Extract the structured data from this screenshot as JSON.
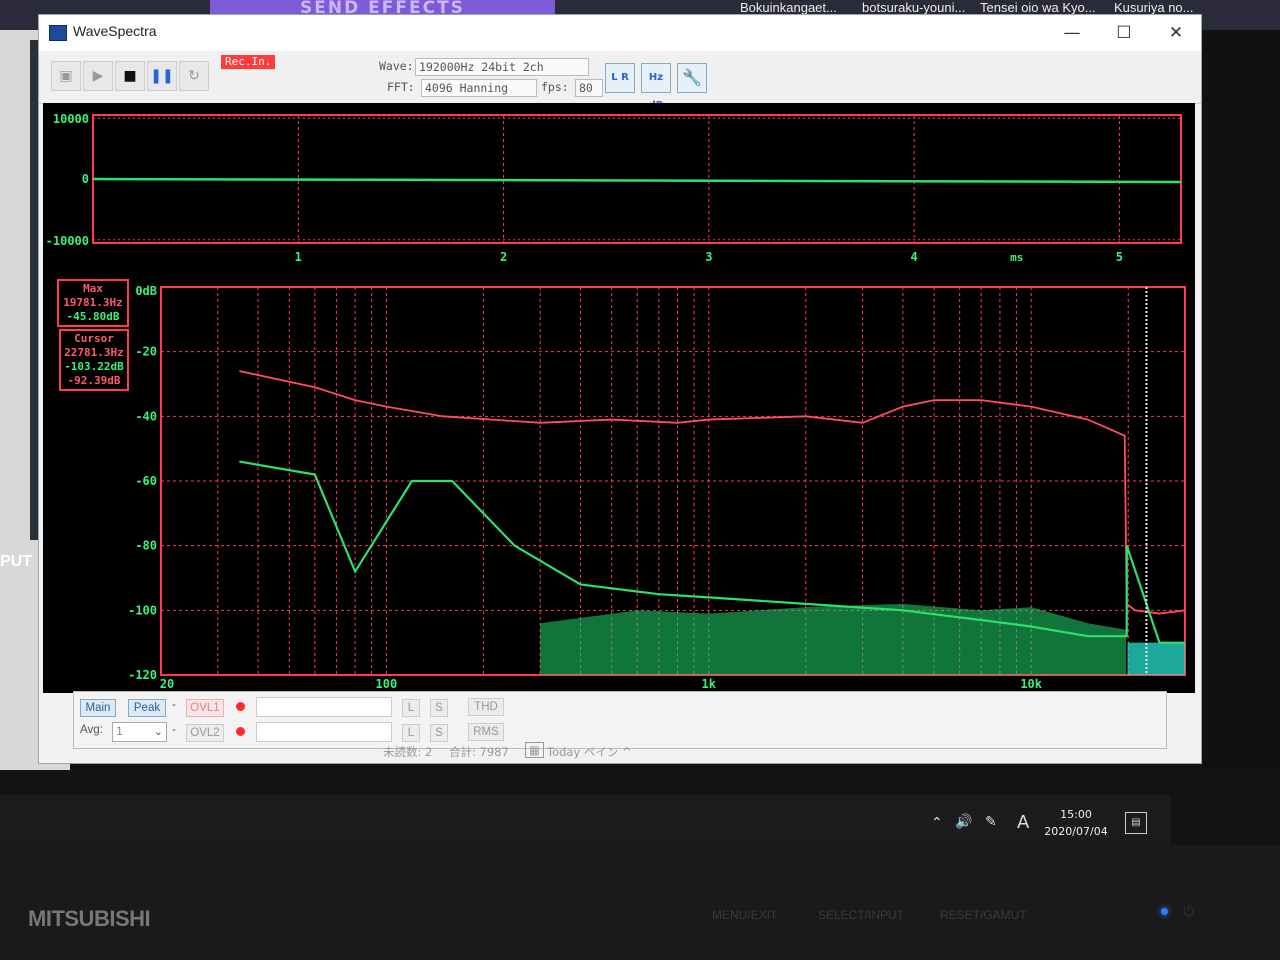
{
  "background": {
    "tabs": [
      "Bokuinkangaet...",
      "botsuraku-youni...",
      "Tensei oio wa Kyo...",
      "Kusuriya no..."
    ],
    "purple_banner": "SEND EFFECTS",
    "left_panel_text": "PUT"
  },
  "window": {
    "title": "WaveSpectra",
    "controls": {
      "minimize": "—",
      "maximize": "☐",
      "close": "✕"
    }
  },
  "toolbar": {
    "rec_label": "Rec.In.",
    "wave_label": "Wave:",
    "wave_value": "192000Hz 24bit 2ch",
    "fft_label": "FFT:",
    "fft_value": "4096 Hanning",
    "fps_label": "fps:",
    "fps_value": "80",
    "icons": [
      "record-disk-icon",
      "play-icon",
      "stop-icon",
      "pause-icon",
      "loop-icon",
      "channel-lr-icon",
      "hz-db-icon",
      "settings-wrench-icon"
    ],
    "lr_label": "L R",
    "hzdb_label": "Hz dB"
  },
  "waveform": {
    "y_ticks": [
      "10000",
      "0",
      "-10000"
    ],
    "x_ticks": [
      "1",
      "2",
      "3",
      "4",
      "5"
    ],
    "x_unit": "ms"
  },
  "spectrum": {
    "y_ticks": [
      "0dB",
      "-20",
      "-40",
      "-60",
      "-80",
      "-100",
      "-120"
    ],
    "x_ticks": [
      "20",
      "100",
      "1k",
      "10k"
    ],
    "max_box": {
      "label": "Max",
      "freq": "19781.3Hz",
      "level": "-45.80dB"
    },
    "cursor_box": {
      "label": "Cursor",
      "freq": "22781.3Hz",
      "level_l": "-103.22dB",
      "level_r": "-92.39dB"
    }
  },
  "bottom": {
    "main": "Main",
    "peak": "Peak",
    "avg_label": "Avg:",
    "avg_value": "1",
    "ovl1": "OVL1",
    "ovl2": "OVL2",
    "l": "L",
    "s": "S",
    "thd": "THD",
    "rms": "RMS",
    "dash": "-"
  },
  "statusline": {
    "unread": "未読数: 2",
    "total": "合計: 7987",
    "pane": "Today ペイン ^"
  },
  "taskbar": {
    "time": "15:00",
    "date": "2020/07/04",
    "ime": "A"
  },
  "monitor": {
    "brand": "MITSUBISHI",
    "buttons": [
      "MENU/EXIT",
      "SELECT/INPUT",
      "RESET/GAMUT"
    ]
  },
  "chart_data": [
    {
      "type": "line",
      "title": "",
      "xlabel": "ms",
      "ylabel": "",
      "xlim": [
        0,
        5.3
      ],
      "ylim": [
        -10000,
        10000
      ],
      "series": [
        {
          "name": "",
          "x": [
            0,
            5.3
          ],
          "values": [
            0,
            0
          ]
        }
      ],
      "grid": true
    },
    {
      "type": "line",
      "title": "",
      "xscale": "log",
      "xlim": [
        20,
        30000
      ],
      "ylim": [
        -120,
        0
      ],
      "xlabel": "",
      "ylabel": "",
      "series": [
        {
          "name": "",
          "color": "#ff4d5e",
          "x": [
            35,
            60,
            80,
            100,
            150,
            300,
            500,
            800,
            1000,
            2000,
            3000,
            4000,
            5000,
            7000,
            10000,
            15000,
            19500,
            19781,
            21000,
            25000,
            30000
          ],
          "values": [
            -26,
            -31,
            -35,
            -37,
            -40,
            -42,
            -41,
            -42,
            -41,
            -40,
            -42,
            -37,
            -35,
            -35,
            -37,
            -41,
            -46,
            -98,
            -100,
            -101,
            -100
          ]
        },
        {
          "name": "",
          "color": "#2ee06a",
          "x": [
            35,
            60,
            80,
            120,
            160,
            250,
            400,
            700,
            1000,
            2000,
            4000,
            7000,
            10000,
            15000,
            19781,
            19800,
            25000,
            30000
          ],
          "values": [
            -54,
            -58,
            -88,
            -60,
            -60,
            -80,
            -92,
            -95,
            -96,
            -98,
            -100,
            -103,
            -105,
            -108,
            -108,
            -80,
            -110,
            -110
          ]
        }
      ],
      "grid": true
    }
  ]
}
